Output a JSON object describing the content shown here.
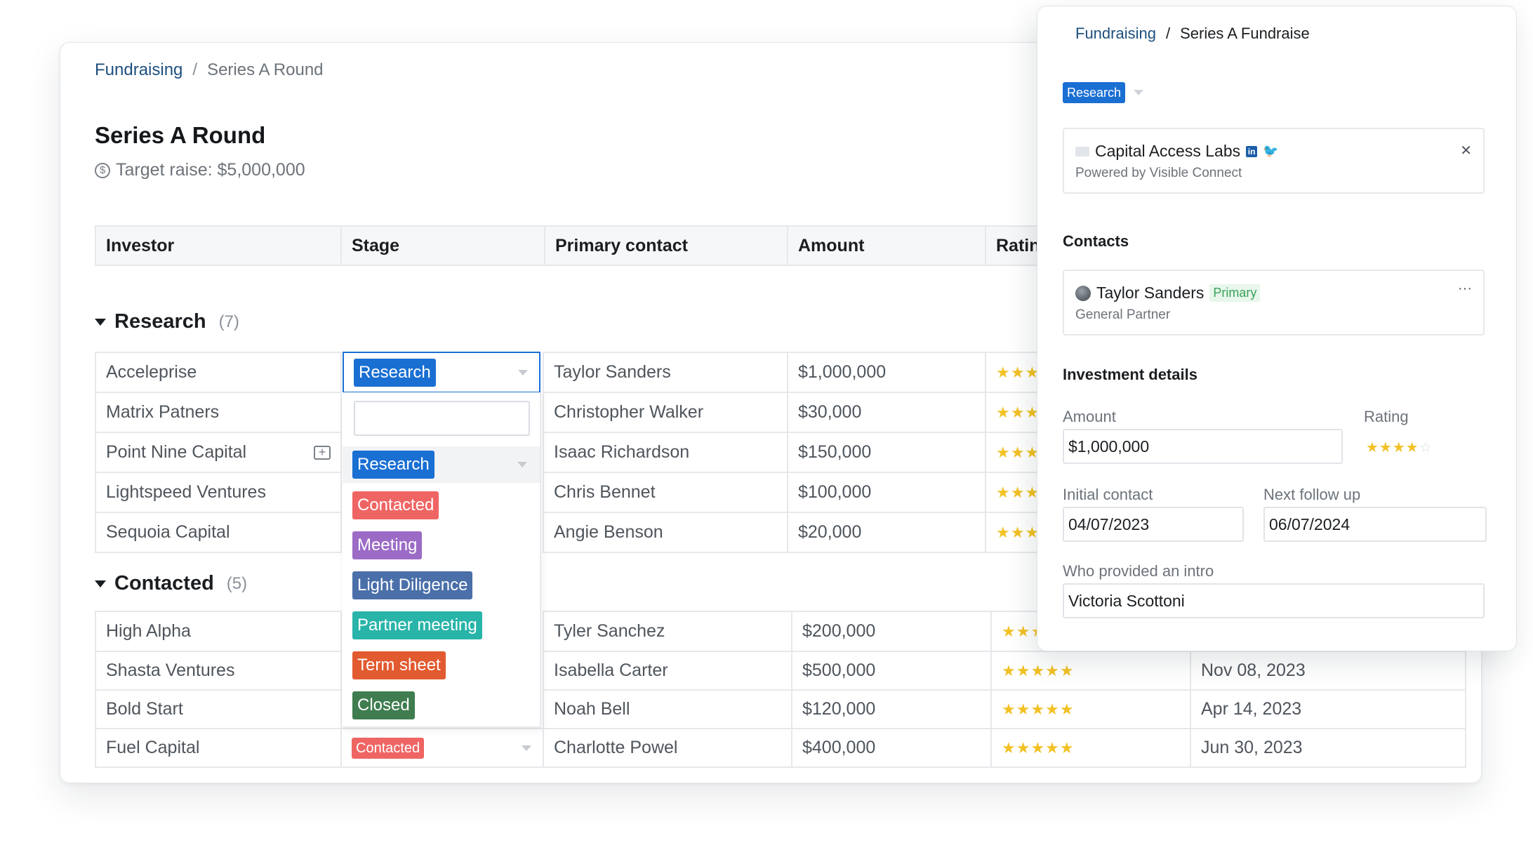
{
  "main": {
    "breadcrumb": {
      "parent": "Fundraising",
      "separator": "/",
      "current": "Series A Round"
    },
    "title": "Series A Round",
    "target": {
      "icon": "dollar-circle-icon",
      "text": "Target raise: $5,000,000"
    },
    "columns": [
      "Investor",
      "Stage",
      "Primary contact",
      "Amount",
      "Ratin"
    ],
    "groups": [
      {
        "name": "Research",
        "count": "(7)",
        "rows": [
          {
            "investor": "Acceleprise",
            "stage": "Research",
            "contact": "Taylor Sanders",
            "amount": "$1,000,000",
            "rating": 3
          },
          {
            "investor": "Matrix Patners",
            "contact": "Christopher Walker",
            "amount": "$30,000",
            "rating": 3
          },
          {
            "investor": "Point Nine Capital",
            "contact": "Isaac Richardson",
            "amount": "$150,000",
            "rating": 3
          },
          {
            "investor": "Lightspeed Ventures",
            "contact": "Chris Bennet",
            "amount": "$100,000",
            "rating": 3
          },
          {
            "investor": "Sequoia Capital",
            "contact": "Angie Benson",
            "amount": "$20,000",
            "rating": 3
          }
        ]
      },
      {
        "name": "Contacted",
        "count": "(5)",
        "rows": [
          {
            "investor": "High Alpha",
            "contact": "Tyler Sanchez",
            "amount": "$200,000",
            "rating": 3,
            "date": ""
          },
          {
            "investor": "Shasta Ventures",
            "contact": "Isabella Carter",
            "amount": "$500,000",
            "rating": 5,
            "date": "Nov 08, 2023"
          },
          {
            "investor": "Bold Start",
            "contact": "Noah Bell",
            "amount": "$120,000",
            "rating": 5,
            "date": "Apr 14, 2023"
          },
          {
            "investor": "Fuel Capital",
            "stage": "Contacted",
            "contact": "Charlotte Powel",
            "amount": "$400,000",
            "rating": 5,
            "date": "Jun 30, 2023"
          }
        ]
      }
    ],
    "stage_dropdown": {
      "search_placeholder": "",
      "selected": "Research",
      "options": [
        "Research",
        "Contacted",
        "Meeting",
        "Light Diligence",
        "Partner meeting",
        "Term sheet",
        "Closed"
      ],
      "option_colors": [
        "#1a6fd3",
        "#ef6564",
        "#9c6bc6",
        "#4a6fa9",
        "#29b4a9",
        "#e25a2f",
        "#3f7d50"
      ]
    },
    "comment_icon": "comment-plus-icon"
  },
  "panel": {
    "breadcrumb": {
      "parent": "Fundraising",
      "separator": "/",
      "current": "Series A Fundraise"
    },
    "stage_tag": "Research",
    "org": {
      "name": "Capital Access Labs",
      "linkedin": "in",
      "powered_by": "Powered by Visible Connect",
      "close": "✕"
    },
    "contacts_title": "Contacts",
    "contact": {
      "name": "Taylor Sanders",
      "badge": "Primary",
      "role": "General Partner",
      "menu": "···"
    },
    "investment_title": "Investment details",
    "amount_label": "Amount",
    "amount_value": "$1,000,000",
    "rating_label": "Rating",
    "rating_value": 4,
    "initial_contact_label": "Initial contact",
    "initial_contact_value": "04/07/2023",
    "next_follow_up_label": "Next follow up",
    "next_follow_up_value": "06/07/2024",
    "intro_label": "Who provided an intro",
    "intro_value": "Victoria Scottoni"
  }
}
